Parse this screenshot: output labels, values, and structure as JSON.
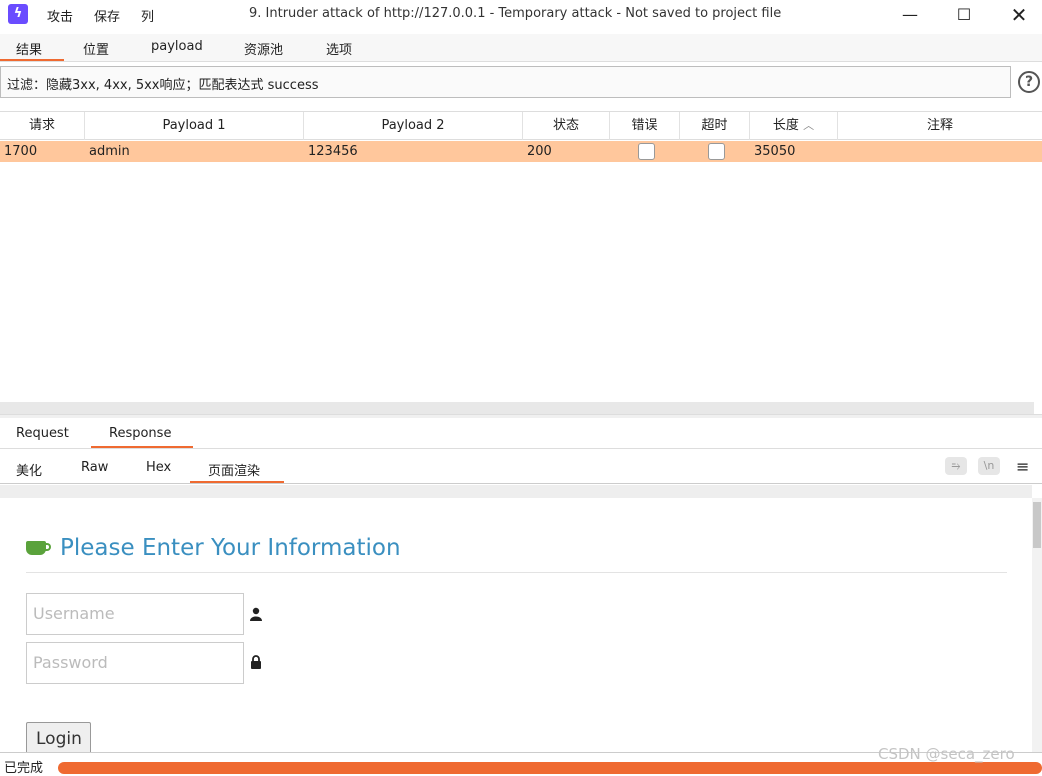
{
  "window": {
    "title": "9. Intruder attack of http://127.0.0.1 - Temporary attack - Not saved to project file",
    "menu": [
      "攻击",
      "保存",
      "列"
    ]
  },
  "tabs": [
    "结果",
    "位置",
    "payload",
    "资源池",
    "选项"
  ],
  "filter": {
    "text": "过滤：隐藏3xx, 4xx, 5xx响应；匹配表达式 success"
  },
  "table": {
    "columns": [
      "请求",
      "Payload 1",
      "Payload 2",
      "状态",
      "错误",
      "超时",
      "长度",
      "注释"
    ],
    "rows": [
      {
        "request": "1700",
        "payload1": "admin",
        "payload2": "123456",
        "status": "200",
        "error": false,
        "timeout": false,
        "length": "35050",
        "comment": ""
      }
    ]
  },
  "message_tabs": [
    "Request",
    "Response"
  ],
  "view_tabs": [
    "美化",
    "Raw",
    "Hex",
    "页面渲染"
  ],
  "render": {
    "heading": "Please Enter Your Information",
    "username_placeholder": "Username",
    "password_placeholder": "Password",
    "login_label": "Login"
  },
  "status": {
    "text": "已完成",
    "progress": 1.0
  },
  "watermark": "CSDN @seca_zero",
  "colors": {
    "accent": "#ef6a31",
    "row_highlight": "#ffc79c",
    "heading": "#3a8fc0"
  }
}
